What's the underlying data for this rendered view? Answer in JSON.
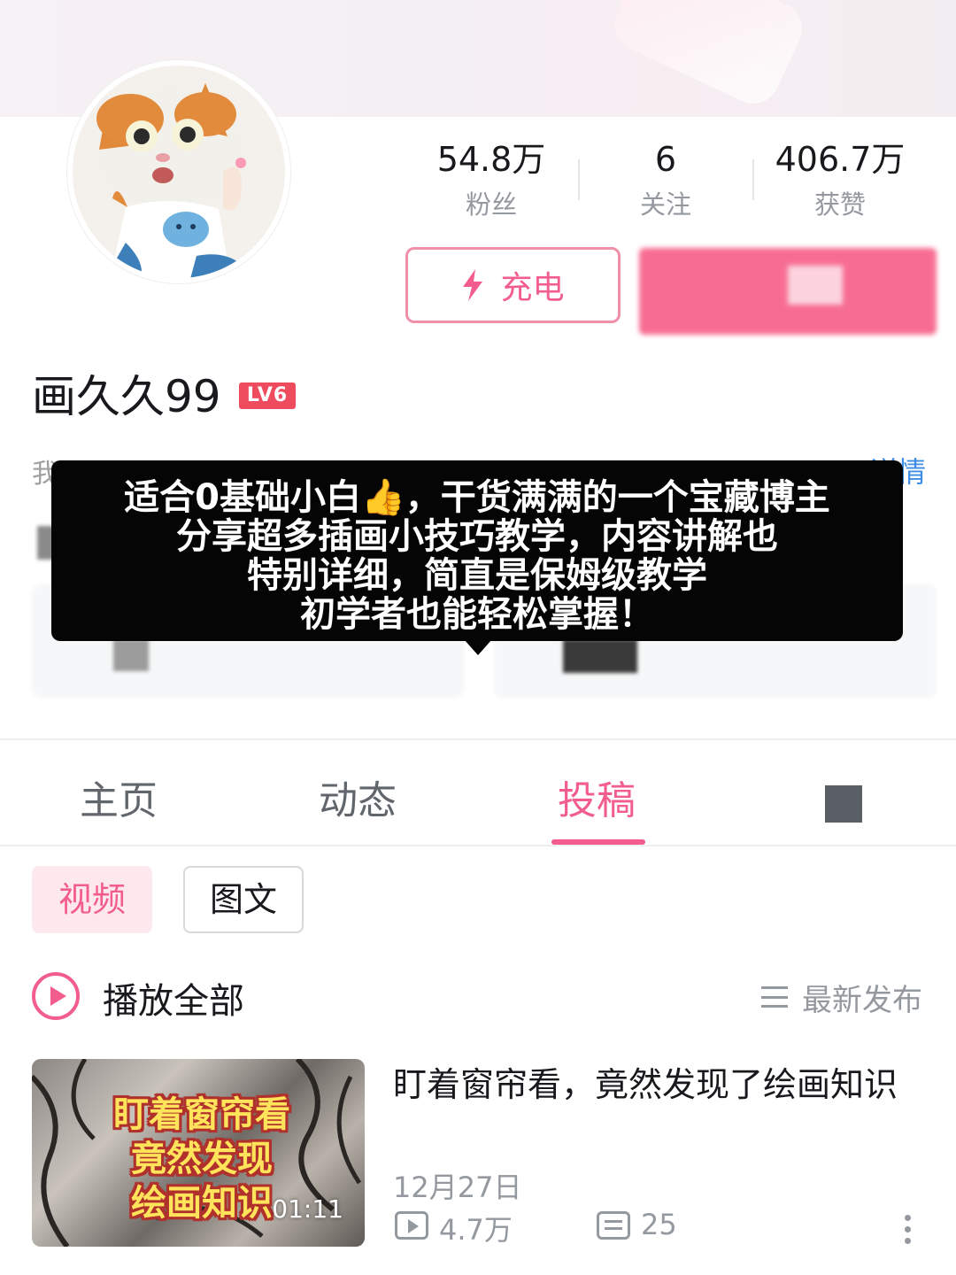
{
  "profile": {
    "name": "画久久99",
    "level": "LV6",
    "bio_partial": "我",
    "detail_link": "详情"
  },
  "stats": [
    {
      "value": "54.8万",
      "label": "粉丝"
    },
    {
      "value": "6",
      "label": "关注"
    },
    {
      "value": "406.7万",
      "label": "获赞"
    }
  ],
  "actions": {
    "charge_label": "充电"
  },
  "overlay": {
    "line1": "适合0基础小白👍，干货满满的一个宝藏博主",
    "line2": "分享超多插画小技巧教学，内容讲解也",
    "line3": "特别详细，简直是保姆级教学",
    "line4": "初学者也能轻松掌握！"
  },
  "tabs": [
    {
      "label": "主页",
      "active": false
    },
    {
      "label": "动态",
      "active": false
    },
    {
      "label": "投稿",
      "active": true
    }
  ],
  "filters": {
    "video": "视频",
    "article": "图文"
  },
  "list_header": {
    "play_all": "播放全部",
    "sort": "最新发布"
  },
  "videos": [
    {
      "thumb_text_1": "盯着窗帘看",
      "thumb_text_2": "竟然发现",
      "thumb_text_3": "绘画知识",
      "duration": "01:11",
      "title": "盯着窗帘看，竟然发现了绘画知识",
      "date": "12月27日",
      "views": "4.7万",
      "danmaku": "25"
    }
  ],
  "colors": {
    "accent": "#f25d8e",
    "level_badge": "#ee4b5e",
    "link": "#3e8de4"
  }
}
